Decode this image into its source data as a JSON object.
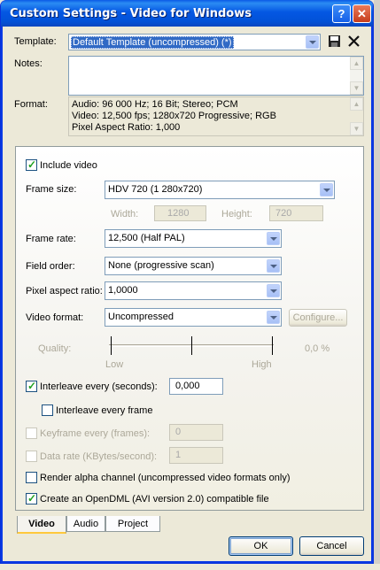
{
  "window": {
    "title": "Custom Settings - Video for Windows"
  },
  "titlebar": {
    "help_label": "?",
    "close_label": "✕"
  },
  "template": {
    "label": "Template:",
    "value": "Default Template (uncompressed) (*)",
    "save_icon": "floppy-disk-icon",
    "delete_icon": "delete-x-icon"
  },
  "notes": {
    "label": "Notes:",
    "value": ""
  },
  "format": {
    "label": "Format:",
    "lines": [
      "Audio: 96 000 Hz; 16 Bit; Stereo; PCM",
      "Video: 12,500 fps; 1280x720 Progressive; RGB",
      "Pixel Aspect Ratio: 1,000"
    ]
  },
  "video": {
    "include_video": {
      "label": "Include video",
      "checked": true
    },
    "frame_size": {
      "label": "Frame size:",
      "value": "HDV 720 (1 280x720)"
    },
    "width": {
      "label": "Width:",
      "value": "1280"
    },
    "height": {
      "label": "Height:",
      "value": "720"
    },
    "frame_rate": {
      "label": "Frame rate:",
      "value": "12,500 (Half PAL)"
    },
    "field_order": {
      "label": "Field order:",
      "value": "None (progressive scan)"
    },
    "pixel_aspect": {
      "label": "Pixel aspect ratio:",
      "value": "1,0000"
    },
    "video_format": {
      "label": "Video format:",
      "value": "Uncompressed",
      "configure_label": "Configure..."
    },
    "quality": {
      "label": "Quality:",
      "low_label": "Low",
      "high_label": "High",
      "value_text": "0,0 %",
      "level": 0.0
    },
    "interleave_seconds": {
      "label": "Interleave every (seconds):",
      "value": "0,000",
      "checked": true
    },
    "interleave_frame": {
      "label": "Interleave every frame",
      "checked": false
    },
    "keyframe": {
      "label": "Keyframe every (frames):",
      "value": "0",
      "checked": false
    },
    "data_rate": {
      "label": "Data rate (KBytes/second):",
      "value": "1",
      "checked": false
    },
    "alpha": {
      "label": "Render alpha channel (uncompressed video formats only)",
      "checked": false
    },
    "opendml": {
      "label": "Create an OpenDML (AVI version 2.0) compatible file",
      "checked": true
    }
  },
  "tabs": [
    {
      "label": "Video",
      "active": true
    },
    {
      "label": "Audio",
      "active": false
    },
    {
      "label": "Project",
      "active": false
    }
  ],
  "buttons": {
    "ok": "OK",
    "cancel": "Cancel"
  },
  "colors": {
    "titlebar": "#0054e3",
    "close": "#c63d1c",
    "check": "#21a121",
    "selection": "#316ac5"
  }
}
